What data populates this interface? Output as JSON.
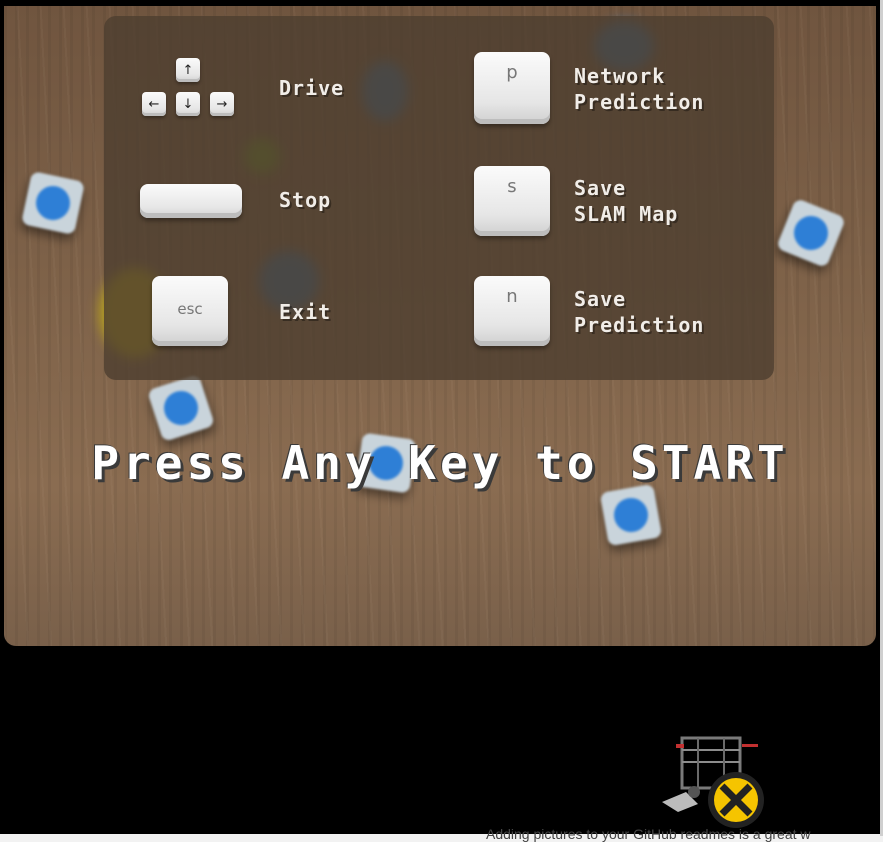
{
  "controls": [
    {
      "key": "arrows",
      "label": "Drive",
      "arrows": {
        "up": "↑",
        "left": "←",
        "down": "↓",
        "right": "→"
      }
    },
    {
      "key": "",
      "label": "Stop"
    },
    {
      "key": "esc",
      "label": "Exit"
    },
    {
      "key": "p",
      "label": "Network\nPrediction"
    },
    {
      "key": "s",
      "label": "Save\nSLAM Map"
    },
    {
      "key": "n",
      "label": "Save\nPrediction"
    }
  ],
  "start_prompt": "Press Any Key to START",
  "background_text": "Adding pictures to your GitHub readmes is a great w",
  "colors": {
    "panel": "#4e3e30",
    "text": "#f1ede8",
    "cube_blue": "#2e7fd6",
    "wheel": "#f5c400"
  }
}
